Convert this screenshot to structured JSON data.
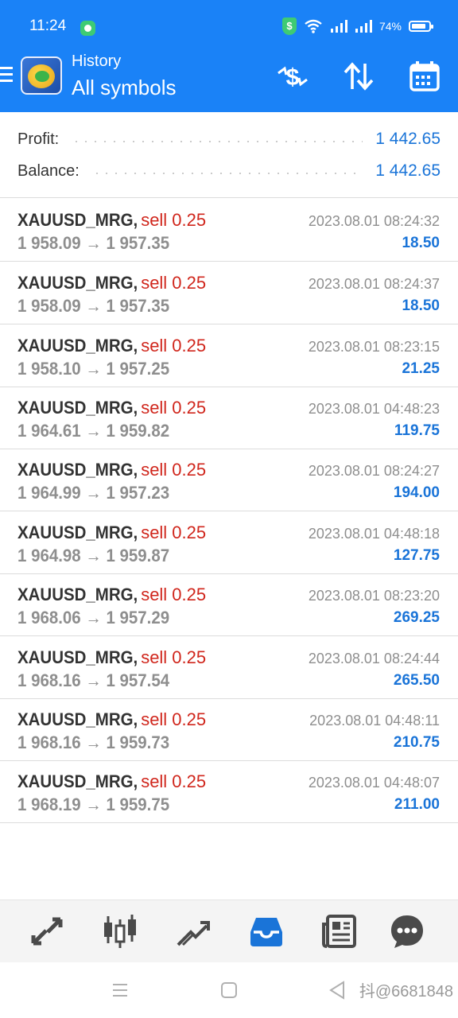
{
  "status_bar": {
    "time": "11:24",
    "battery": "74%"
  },
  "header": {
    "title": "History",
    "subtitle": "All symbols"
  },
  "summary": {
    "profit_label": "Profit:",
    "profit_value": "1 442.65",
    "balance_label": "Balance:",
    "balance_value": "1 442.65"
  },
  "deals": [
    {
      "symbol": "XAUUSD_MRG,",
      "side": "sell 0.25",
      "prices": "1 958.09 → 1 957.35",
      "datetime": "2023.08.01 08:24:32",
      "profit": "18.50"
    },
    {
      "symbol": "XAUUSD_MRG,",
      "side": "sell 0.25",
      "prices": "1 958.09 → 1 957.35",
      "datetime": "2023.08.01 08:24:37",
      "profit": "18.50"
    },
    {
      "symbol": "XAUUSD_MRG,",
      "side": "sell 0.25",
      "prices": "1 958.10 → 1 957.25",
      "datetime": "2023.08.01 08:23:15",
      "profit": "21.25"
    },
    {
      "symbol": "XAUUSD_MRG,",
      "side": "sell 0.25",
      "prices": "1 964.61 → 1 959.82",
      "datetime": "2023.08.01 04:48:23",
      "profit": "119.75"
    },
    {
      "symbol": "XAUUSD_MRG,",
      "side": "sell 0.25",
      "prices": "1 964.99 → 1 957.23",
      "datetime": "2023.08.01 08:24:27",
      "profit": "194.00"
    },
    {
      "symbol": "XAUUSD_MRG,",
      "side": "sell 0.25",
      "prices": "1 964.98 → 1 959.87",
      "datetime": "2023.08.01 04:48:18",
      "profit": "127.75"
    },
    {
      "symbol": "XAUUSD_MRG,",
      "side": "sell 0.25",
      "prices": "1 968.06 → 1 957.29",
      "datetime": "2023.08.01 08:23:20",
      "profit": "269.25"
    },
    {
      "symbol": "XAUUSD_MRG,",
      "side": "sell 0.25",
      "prices": "1 968.16 → 1 957.54",
      "datetime": "2023.08.01 08:24:44",
      "profit": "265.50"
    },
    {
      "symbol": "XAUUSD_MRG,",
      "side": "sell 0.25",
      "prices": "1 968.16 → 1 959.73",
      "datetime": "2023.08.01 04:48:11",
      "profit": "210.75"
    },
    {
      "symbol": "XAUUSD_MRG,",
      "side": "sell 0.25",
      "prices": "1 968.19 → 1 959.75",
      "datetime": "2023.08.01 04:48:07",
      "profit": "211.00"
    }
  ],
  "bottom_nav": {
    "items": [
      {
        "icon": "quotes-icon",
        "active": false
      },
      {
        "icon": "chart-icon",
        "active": false
      },
      {
        "icon": "trade-icon",
        "active": false
      },
      {
        "icon": "history-icon",
        "active": true
      },
      {
        "icon": "news-icon",
        "active": false
      },
      {
        "icon": "messages-icon",
        "active": false
      }
    ]
  },
  "watermark": "抖@6681848",
  "colors": {
    "header_bg": "#1a82f7",
    "accent_blue": "#1a74d8",
    "sell_red": "#d0261c",
    "muted_gray": "#8e8e8e",
    "nav_icon": "#4a4a4a"
  }
}
